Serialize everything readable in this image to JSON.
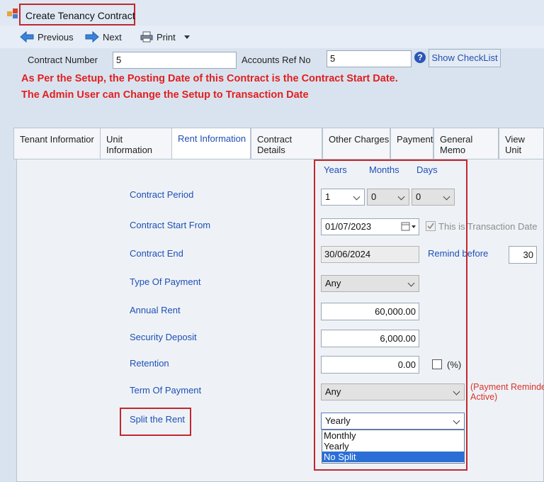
{
  "window": {
    "title": "Create Tenancy Contract"
  },
  "toolbar": {
    "previous": "Previous",
    "next": "Next",
    "print": "Print"
  },
  "header": {
    "contract_number_label": "Contract Number",
    "contract_number_value": "5",
    "accounts_ref_label": "Accounts Ref No",
    "accounts_ref_value": "5",
    "checklist_button": "Show CheckList"
  },
  "notices": [
    "As Per the Setup, the Posting Date of this Contract is the Contract Start Date.",
    "The Admin User can Change the Setup to Transaction Date"
  ],
  "tabs": [
    {
      "label": "Tenant Informatior",
      "active": false
    },
    {
      "label": "Unit\nInformation",
      "active": false
    },
    {
      "label": "Rent Information",
      "active": true
    },
    {
      "label": "Contract Details",
      "active": false
    },
    {
      "label": "Other Charges",
      "active": false
    },
    {
      "label": "Payment",
      "active": false
    },
    {
      "label": "General Memo",
      "active": false
    },
    {
      "label": "View Unit",
      "active": false
    }
  ],
  "rent": {
    "period_headers": {
      "years": "Years",
      "months": "Months",
      "days": "Days"
    },
    "contract_period_label": "Contract Period",
    "period_years": "1",
    "period_months": "0",
    "period_days": "0",
    "start_label": "Contract Start From",
    "start_value": "01/07/2023",
    "transaction_date_label": "This is Transaction Date",
    "end_label": "Contract End",
    "end_value": "30/06/2024",
    "remind_before_label": "Remind before",
    "remind_before_value": "30",
    "type_of_payment_label": "Type Of Payment",
    "type_of_payment_value": "Any",
    "annual_rent_label": "Annual Rent",
    "annual_rent_value": "60,000.00",
    "security_deposit_label": "Security Deposit",
    "security_deposit_value": "6,000.00",
    "retention_label": "Retention",
    "retention_value": "0.00",
    "retention_pct_label": "(%)",
    "term_of_payment_label": "Term Of Payment",
    "term_of_payment_value": "Any",
    "payment_reminder_note_1": "(Payment Reminder",
    "payment_reminder_note_2": "Active)",
    "split_label": "Split the Rent",
    "split_value": "Yearly",
    "split_options": [
      "Monthly",
      "Yearly",
      "No Split"
    ],
    "split_highlighted": "No Split"
  },
  "colors": {
    "accent": "#1f4fb4",
    "warning": "#e02020",
    "highlight_box": "#c0282e",
    "selection": "#2b6fd6"
  }
}
